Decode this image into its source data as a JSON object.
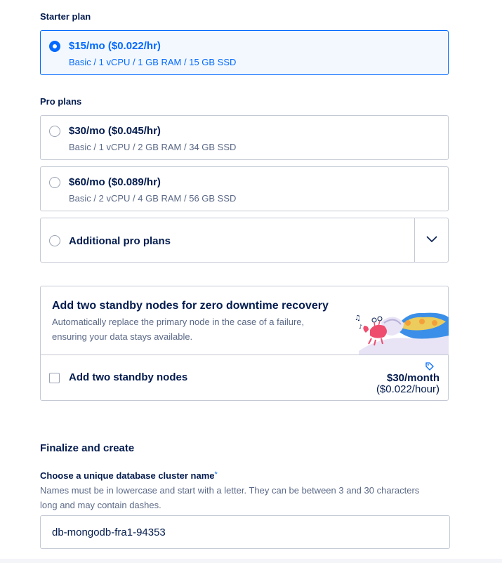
{
  "starter": {
    "label": "Starter plan",
    "plan": {
      "price": "$15/mo ($0.022/hr)",
      "specs": "Basic / 1 vCPU / 1 GB RAM / 15 GB SSD",
      "selected": true
    }
  },
  "pro": {
    "label": "Pro plans",
    "plans": [
      {
        "price": "$30/mo ($0.045/hr)",
        "specs": "Basic / 1 vCPU / 2 GB RAM / 34 GB SSD"
      },
      {
        "price": "$60/mo ($0.089/hr)",
        "specs": "Basic / 2 vCPU / 4 GB RAM / 56 GB SSD"
      }
    ],
    "additional_label": "Additional pro plans"
  },
  "standby": {
    "title": "Add two standby nodes for zero downtime recovery",
    "description_line1": "Automatically replace the primary node in the case of a failure,",
    "description_line2": "ensuring your data stays available.",
    "checkbox_label": "Add two standby nodes",
    "price_month": "$30/month",
    "price_hour": "($0.022/hour)"
  },
  "finalize": {
    "heading": "Finalize and create",
    "field_label": "Choose a unique database cluster name",
    "required_mark": "*",
    "help_line1": "Names must be in lowercase and start with a letter. They can be between 3 and 30 characters",
    "help_line2": "long and may contain dashes.",
    "cluster_name": "db-mongodb-fra1-94353"
  },
  "colors": {
    "accent": "#0069ff",
    "text": "#031b4e",
    "muted": "#5b6987",
    "border": "#c4c9d4"
  }
}
